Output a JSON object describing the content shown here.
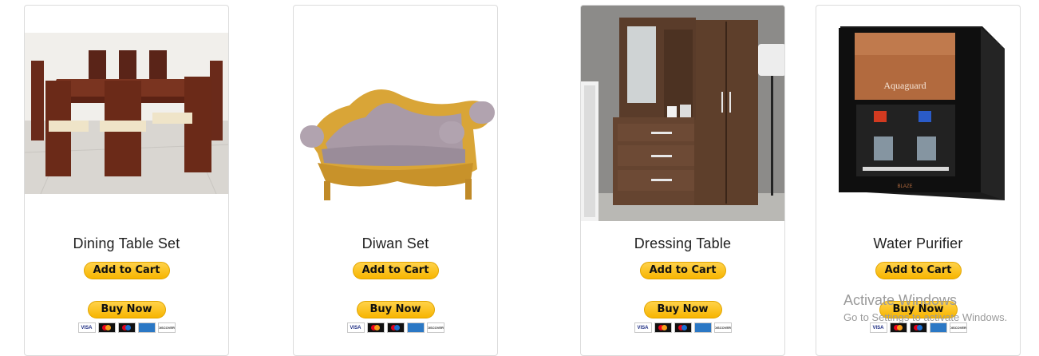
{
  "products": [
    {
      "name": "Dining Table Set",
      "image_icon": "dining-table-set-image"
    },
    {
      "name": "Diwan Set",
      "image_icon": "diwan-sofa-image"
    },
    {
      "name": "Dressing Table",
      "image_icon": "dressing-table-image"
    },
    {
      "name": "Water Purifier",
      "image_icon": "water-purifier-image"
    }
  ],
  "buttons": {
    "add_to_cart": "Add to Cart",
    "buy_now": "Buy Now"
  },
  "payment": {
    "visa": "VISA",
    "discover": "DISCOVER"
  },
  "purifier_brand": "Aquaguard",
  "purifier_model": "BLAZE",
  "watermark": {
    "title": "Activate Windows",
    "subtitle": "Go to Settings to activate Windows."
  },
  "colors": {
    "button": "#ffc439",
    "card_border": "#dcdcdc"
  }
}
